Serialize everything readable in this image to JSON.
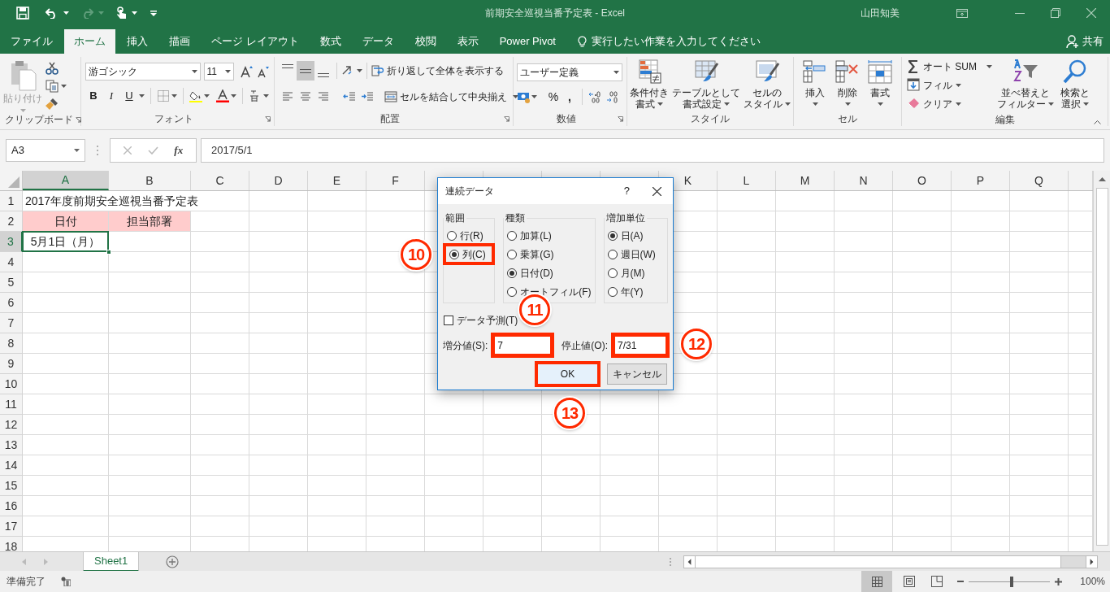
{
  "window": {
    "title": "前期安全巡視当番予定表  -  Excel",
    "user": "山田知美"
  },
  "ribbon_tabs": [
    {
      "label": "ファイル",
      "selected": false
    },
    {
      "label": "ホーム",
      "selected": true
    },
    {
      "label": "挿入",
      "selected": false
    },
    {
      "label": "描画",
      "selected": false
    },
    {
      "label": "ページ レイアウト",
      "selected": false
    },
    {
      "label": "数式",
      "selected": false
    },
    {
      "label": "データ",
      "selected": false
    },
    {
      "label": "校閲",
      "selected": false
    },
    {
      "label": "表示",
      "selected": false
    },
    {
      "label": "Power Pivot",
      "selected": false
    }
  ],
  "tell_me": {
    "placeholder": "実行したい作業を入力してください"
  },
  "share": "共有",
  "ribbon": {
    "clipboard": {
      "name": "クリップボード",
      "paste": {
        "label": "貼り付け",
        "disabled": true
      }
    },
    "font": {
      "name": "フォント",
      "font_name": "游ゴシック",
      "font_size": "11",
      "bold": "B",
      "italic": "I",
      "underline": "U"
    },
    "alignment": {
      "name": "配置",
      "vertical": [
        {
          "selected": false
        },
        {
          "selected": true
        },
        {
          "selected": false
        }
      ],
      "wrap_text": "折り返して全体を表示する",
      "merge": "セルを結合して中央揃え"
    },
    "number": {
      "name": "数値",
      "format": "ユーザー定義",
      "percent": "%",
      "comma": ","
    },
    "styles": {
      "name": "スタイル",
      "buttons": [
        {
          "label": [
            "条件付き",
            "書式"
          ],
          "kind": "conditional"
        },
        {
          "label": [
            "テーブルとして",
            "書式設定"
          ],
          "kind": "table"
        },
        {
          "label": [
            "セルの",
            "スタイル"
          ],
          "kind": "cellstyle"
        }
      ]
    },
    "cells": {
      "name": "セル",
      "buttons": [
        {
          "label": [
            "挿入"
          ],
          "kind": "insert"
        },
        {
          "label": [
            "削除"
          ],
          "kind": "delete"
        },
        {
          "label": [
            "書式"
          ],
          "kind": "format"
        }
      ]
    },
    "editing": {
      "name": "編集",
      "small": [
        {
          "label": "オート SUM",
          "kind": "sum"
        },
        {
          "label": "フィル",
          "kind": "fill"
        },
        {
          "label": "クリア",
          "kind": "clear"
        }
      ],
      "large": [
        {
          "label": [
            "並べ替えと",
            "フィルター"
          ],
          "kind": "sort"
        },
        {
          "label": [
            "検索と",
            "選択"
          ],
          "kind": "find"
        }
      ]
    }
  },
  "formula_bar": {
    "name_box": "A3",
    "function_label": "fx",
    "value": "2017/5/1"
  },
  "columns": [
    {
      "letter": "A"
    },
    {
      "letter": "B"
    },
    {
      "letter": "C"
    },
    {
      "letter": "D"
    },
    {
      "letter": "E"
    },
    {
      "letter": "F"
    },
    {},
    {},
    {},
    {},
    {
      "letter": "K"
    },
    {
      "letter": "L"
    },
    {
      "letter": "M"
    },
    {
      "letter": "N"
    },
    {
      "letter": "O"
    },
    {
      "letter": "P"
    },
    {
      "letter": "Q"
    },
    {}
  ],
  "rows": [
    {
      "header": "1",
      "cells": [
        {
          "text": "2017年度前期安全巡視当番予定表",
          "centered": false,
          "selected": false
        }
      ]
    },
    {
      "header": "2",
      "cells": [
        {
          "text": "日付",
          "centered": true,
          "color": "#ffcccc",
          "selected": false
        },
        {
          "text": "担当部署",
          "centered": true,
          "color": "#ffcccc",
          "selected": false
        }
      ]
    },
    {
      "header": "3",
      "cells": [
        {
          "text": "5月1日（月）",
          "centered": true,
          "selected": true
        }
      ]
    },
    {
      "header": "4"
    },
    {
      "header": "5"
    },
    {
      "header": "6"
    },
    {
      "header": "7"
    },
    {
      "header": "8"
    },
    {
      "header": "9"
    },
    {
      "header": "10"
    },
    {
      "header": "11"
    },
    {
      "header": "12"
    },
    {
      "header": "13"
    },
    {
      "header": "14"
    },
    {
      "header": "15"
    },
    {
      "header": "16"
    },
    {
      "header": "17"
    },
    {
      "header": "18"
    }
  ],
  "dialog": {
    "title": "連続データ",
    "help": "?",
    "groups": [
      {
        "label": "範囲",
        "options": [
          {
            "label": "行(R)",
            "selected": false,
            "highlighted": false
          },
          {
            "label": "列(C)",
            "selected": true,
            "highlighted": true
          }
        ]
      },
      {
        "label": "種類",
        "options": [
          {
            "label": "加算(L)",
            "selected": false,
            "highlighted": false
          },
          {
            "label": "乗算(G)",
            "selected": false,
            "highlighted": false
          },
          {
            "label": "日付(D)",
            "selected": true,
            "highlighted": false
          },
          {
            "label": "オートフィル(F)",
            "selected": false,
            "highlighted": false
          }
        ]
      },
      {
        "label": "増加単位",
        "options": [
          {
            "label": "日(A)",
            "selected": true,
            "highlighted": false
          },
          {
            "label": "週日(W)",
            "selected": false,
            "highlighted": false
          },
          {
            "label": "月(M)",
            "selected": false,
            "highlighted": false
          },
          {
            "label": "年(Y)",
            "selected": false,
            "highlighted": false
          }
        ]
      }
    ],
    "trend": {
      "label": "データ予測(T)",
      "checked": false
    },
    "fields": [
      {
        "label": "増分値(S):",
        "value": "7",
        "highlighted": true
      },
      {
        "label": "停止値(O):",
        "value": "7/31",
        "highlighted": true
      }
    ],
    "buttons": [
      {
        "label": "OK",
        "highlighted": true
      },
      {
        "label": "キャンセル",
        "highlighted": false
      }
    ]
  },
  "annotations": [
    {
      "label": "10"
    },
    {
      "label": "11"
    },
    {
      "label": "12"
    },
    {
      "label": "13"
    }
  ],
  "sheet_tabs": [
    {
      "label": "Sheet1",
      "selected": true
    }
  ],
  "status": "準備完了",
  "zoom": {
    "label": "100%",
    "level": 0.53
  }
}
